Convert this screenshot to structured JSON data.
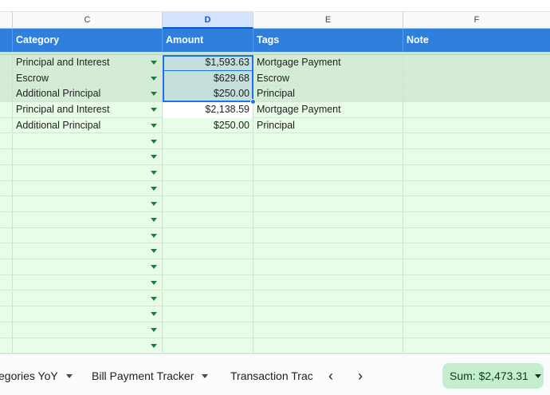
{
  "columns": [
    {
      "letter": "C"
    },
    {
      "letter": "D"
    },
    {
      "letter": "E"
    },
    {
      "letter": "F"
    }
  ],
  "header": {
    "category": "Category",
    "amount": "Amount",
    "tags": "Tags",
    "note": "Note"
  },
  "rows": [
    {
      "category": "Principal and Interest",
      "amount": "$1,593.63",
      "tags": "Mortgage Payment",
      "note": ""
    },
    {
      "category": "Escrow",
      "amount": "$629.68",
      "tags": "Escrow",
      "note": ""
    },
    {
      "category": "Additional Principal",
      "amount": "$250.00",
      "tags": "Principal",
      "note": ""
    },
    {
      "category": "Principal and Interest",
      "amount": "$2,138.59",
      "tags": "Mortgage Payment",
      "note": ""
    },
    {
      "category": "Additional Principal",
      "amount": "$250.00",
      "tags": "Principal",
      "note": ""
    }
  ],
  "empty_rows": 14,
  "sheet_tabs": [
    {
      "label": "egories YoY"
    },
    {
      "label": "Bill Payment Tracker"
    },
    {
      "label": "Transaction Trac"
    }
  ],
  "nav": {
    "prev": "‹",
    "next": "›"
  },
  "sum_label": "Sum: $2,473.31",
  "colors": {
    "header_blue": "#2f80dd",
    "grid_green": "#e8fde8",
    "selection_blue": "#1a73e8"
  }
}
